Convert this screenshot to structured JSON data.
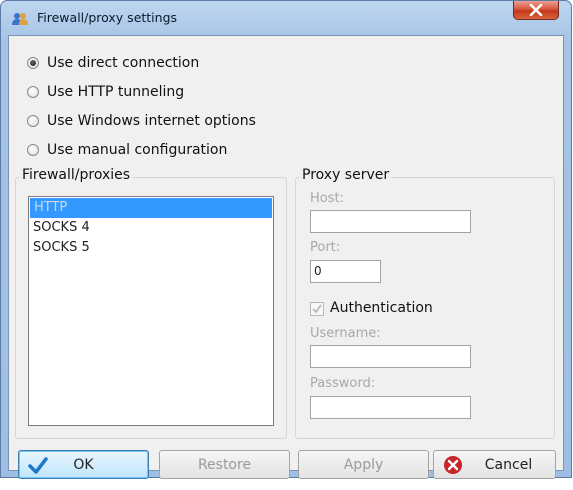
{
  "window": {
    "title": "Firewall/proxy settings"
  },
  "connection_options": [
    {
      "label": "Use direct connection",
      "selected": true
    },
    {
      "label": "Use HTTP tunneling",
      "selected": false
    },
    {
      "label": "Use Windows internet options",
      "selected": false
    },
    {
      "label": "Use manual configuration",
      "selected": false
    }
  ],
  "firewall_group": {
    "title": "Firewall/proxies",
    "items": [
      "HTTP",
      "SOCKS 4",
      "SOCKS 5"
    ],
    "selected_index": 0
  },
  "proxy_group": {
    "title": "Proxy server",
    "host_label": "Host:",
    "host_value": "",
    "port_label": "Port:",
    "port_value": "0",
    "auth_label": "Authentication",
    "auth_checked": true,
    "username_label": "Username:",
    "username_value": "",
    "password_label": "Password:",
    "password_value": ""
  },
  "buttons": {
    "ok": "OK",
    "restore": "Restore",
    "apply": "Apply",
    "cancel": "Cancel"
  },
  "colors": {
    "selection": "#3399ff",
    "accent": "#1e78c8",
    "cancel_icon": "#c6252b"
  }
}
